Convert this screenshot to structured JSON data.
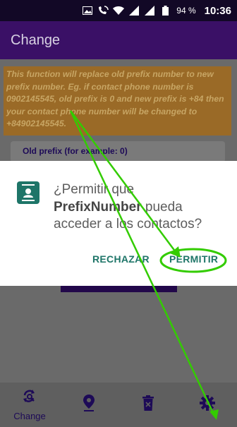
{
  "status_bar": {
    "battery": "94 %",
    "time": "10:36",
    "icons": [
      "image-icon",
      "phone-wifi-icon",
      "wifi-icon",
      "signal-icon",
      "signal-icon",
      "battery-icon"
    ]
  },
  "app_bar": {
    "title": "Change"
  },
  "content": {
    "notice": "This function will replace old prefix number to new prefix number. Eg. if contact phone number is 0902145545, old prefix is 0 and new prefix is +84 then your contact phone number will be changed to +84902145545.",
    "old_prefix_label": "Old prefix (for example: 0)"
  },
  "dialog": {
    "icon": "contacts-icon",
    "message_before": "¿Permitir que ",
    "app_name": "PrefixNumber",
    "message_after": " pueda acceder a los contactos?",
    "deny_label": "RECHAZAR",
    "allow_label": "PERMITIR"
  },
  "bottom_nav": {
    "items": [
      {
        "label": "Change",
        "icon": "refresh-search-icon"
      },
      {
        "label": "",
        "icon": "location-pin-icon"
      },
      {
        "label": "",
        "icon": "trash-icon"
      },
      {
        "label": "",
        "icon": "gear-icon"
      }
    ]
  },
  "colors": {
    "accent": "#1e7568",
    "app_bar": "#3a1066",
    "annotation": "#33cc00"
  }
}
